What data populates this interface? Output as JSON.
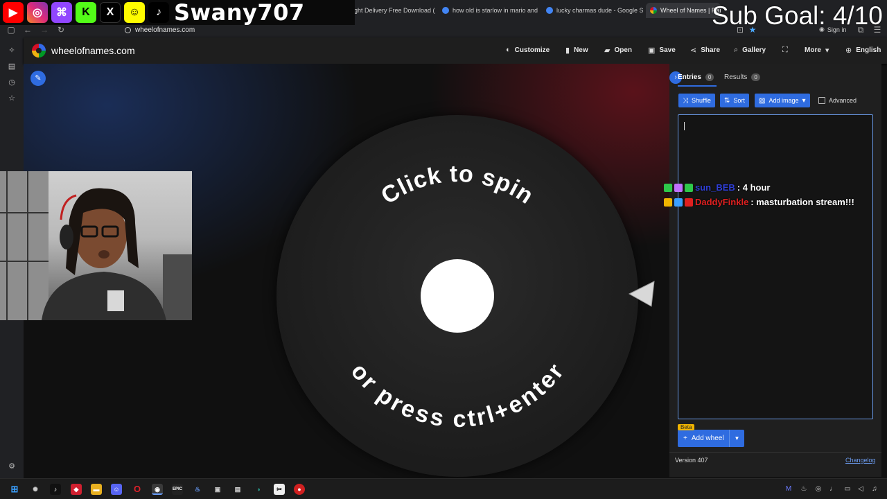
{
  "browser": {
    "tabs": [
      {
        "title": "ght Delivery Free Download (",
        "active": false
      },
      {
        "title": "how old is starlow in mario and",
        "active": false
      },
      {
        "title": "lucky charmas dude - Google S",
        "active": false
      },
      {
        "title": "Wheel of Names | Random n",
        "active": true
      }
    ],
    "url": "wheelofnames.com",
    "signin_label": "Sign in"
  },
  "overlay": {
    "streamer_name": "Swany707",
    "sub_goal": "Sub Goal: 4/10",
    "social_icons": [
      "youtube-icon",
      "instagram-icon",
      "twitch-icon",
      "kick-icon",
      "x-icon",
      "snapchat-icon",
      "tiktok-icon"
    ]
  },
  "nav": {
    "brand": "wheelofnames.com",
    "items": [
      {
        "label": "Customize",
        "icon": "palette-icon"
      },
      {
        "label": "New",
        "icon": "file-icon"
      },
      {
        "label": "Open",
        "icon": "folder-icon"
      },
      {
        "label": "Save",
        "icon": "save-icon"
      },
      {
        "label": "Share",
        "icon": "share-icon"
      },
      {
        "label": "Gallery",
        "icon": "search-icon"
      },
      {
        "label": "",
        "icon": "fullscreen-icon"
      },
      {
        "label": "More",
        "icon": "chevron-down-icon"
      },
      {
        "label": "English",
        "icon": "globe-icon"
      }
    ]
  },
  "wheel": {
    "top_text": "Click to spin",
    "bottom_text": "or press ctrl+enter"
  },
  "panel": {
    "tabs": [
      {
        "label": "Entries",
        "count": "0"
      },
      {
        "label": "Results",
        "count": "0"
      }
    ],
    "buttons": {
      "shuffle": "Shuffle",
      "sort": "Sort",
      "add_image": "Add image",
      "advanced": "Advanced"
    },
    "beta_badge": "Beta",
    "add_wheel": "Add wheel",
    "version": "Version 407",
    "changelog": "Changelog"
  },
  "chat": [
    {
      "user": "sun_BEB",
      "message": ": 4 hour"
    },
    {
      "user": "DaddyFinkle",
      "message": ": masturbation stream!!!"
    }
  ],
  "colors": {
    "accent": "#2f6ce0",
    "beta": "#f0b400",
    "chat_user_red": "#e02020"
  }
}
